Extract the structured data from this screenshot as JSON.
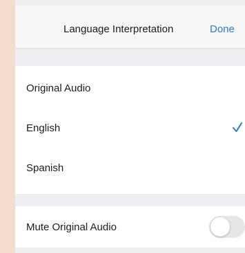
{
  "navbar": {
    "title": "Language Interpretation",
    "done_label": "Done"
  },
  "languages": {
    "items": [
      {
        "label": "Original Audio",
        "selected": false
      },
      {
        "label": "English",
        "selected": true
      },
      {
        "label": "Spanish",
        "selected": false
      }
    ],
    "check_icon": "checkmark-icon"
  },
  "mute": {
    "label": "Mute Original Audio",
    "toggle_on": false
  },
  "colors": {
    "accent": "#2a7ad6",
    "background": "#f4dccc",
    "grouped_background": "#efeff3"
  }
}
